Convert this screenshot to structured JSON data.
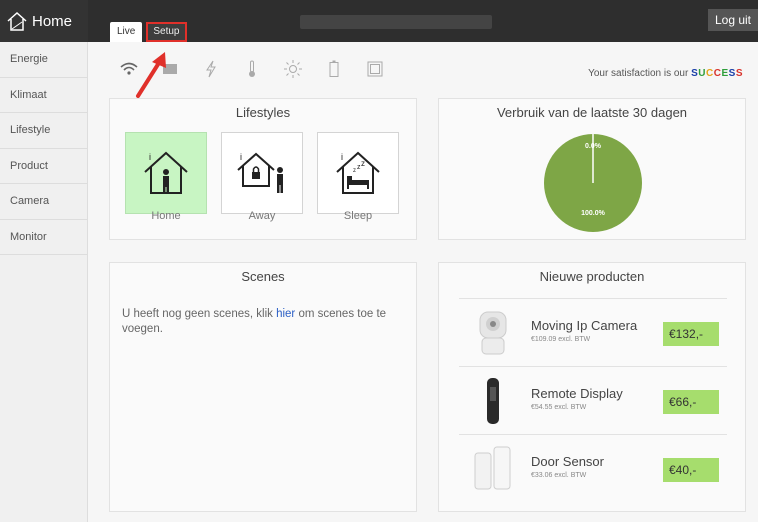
{
  "header": {
    "brand": "Home",
    "tabs": [
      {
        "label": "Live"
      },
      {
        "label": "Setup"
      }
    ],
    "logout": "Log uit"
  },
  "sidebar": {
    "items": [
      {
        "label": "Energie"
      },
      {
        "label": "Klimaat"
      },
      {
        "label": "Lifestyle"
      },
      {
        "label": "Product"
      },
      {
        "label": "Camera"
      },
      {
        "label": "Monitor"
      }
    ]
  },
  "status_icons": [
    "wifi-icon",
    "device-icon",
    "power-icon",
    "thermometer-icon",
    "sun-icon",
    "battery-icon",
    "display-icon"
  ],
  "satisfaction": {
    "prefix": "Your satisfaction is our ",
    "word": "SUCCESS",
    "letter_colors": [
      "#1a3fa8",
      "#2e9e3a",
      "#e4a41b",
      "#d8332c",
      "#2e9e3a",
      "#1a3fa8",
      "#d8332c"
    ]
  },
  "lifestyles": {
    "title": "Lifestyles",
    "items": [
      {
        "label": "Home",
        "active": true
      },
      {
        "label": "Away",
        "active": false
      },
      {
        "label": "Sleep",
        "active": false
      }
    ]
  },
  "verbruik": {
    "title": "Verbruik van de laatste 30 dagen",
    "slices": [
      {
        "label": "0.0%",
        "value": 0.0
      },
      {
        "label": "100.0%",
        "value": 100.0
      }
    ],
    "color": "#7ea646"
  },
  "scenes": {
    "title": "Scenes",
    "text_before": "U heeft nog geen scenes, klik ",
    "link": "hier",
    "text_after": " om scenes toe te voegen."
  },
  "products": {
    "title": "Nieuwe producten",
    "items": [
      {
        "name": "Moving Ip Camera",
        "sub": "€109.09 excl. BTW",
        "price": "€132,-",
        "icon": "camera-product-icon"
      },
      {
        "name": "Remote Display",
        "sub": "€54.55 excl. BTW",
        "price": "€66,-",
        "icon": "remote-product-icon"
      },
      {
        "name": "Door Sensor",
        "sub": "€33.06 excl. BTW",
        "price": "€40,-",
        "icon": "sensor-product-icon"
      }
    ]
  },
  "colors": {
    "topbar": "#2e2e2e",
    "active_lifestyle": "#c8f5c3",
    "price_badge": "#a6dd6d",
    "highlight": "#e0302a"
  }
}
